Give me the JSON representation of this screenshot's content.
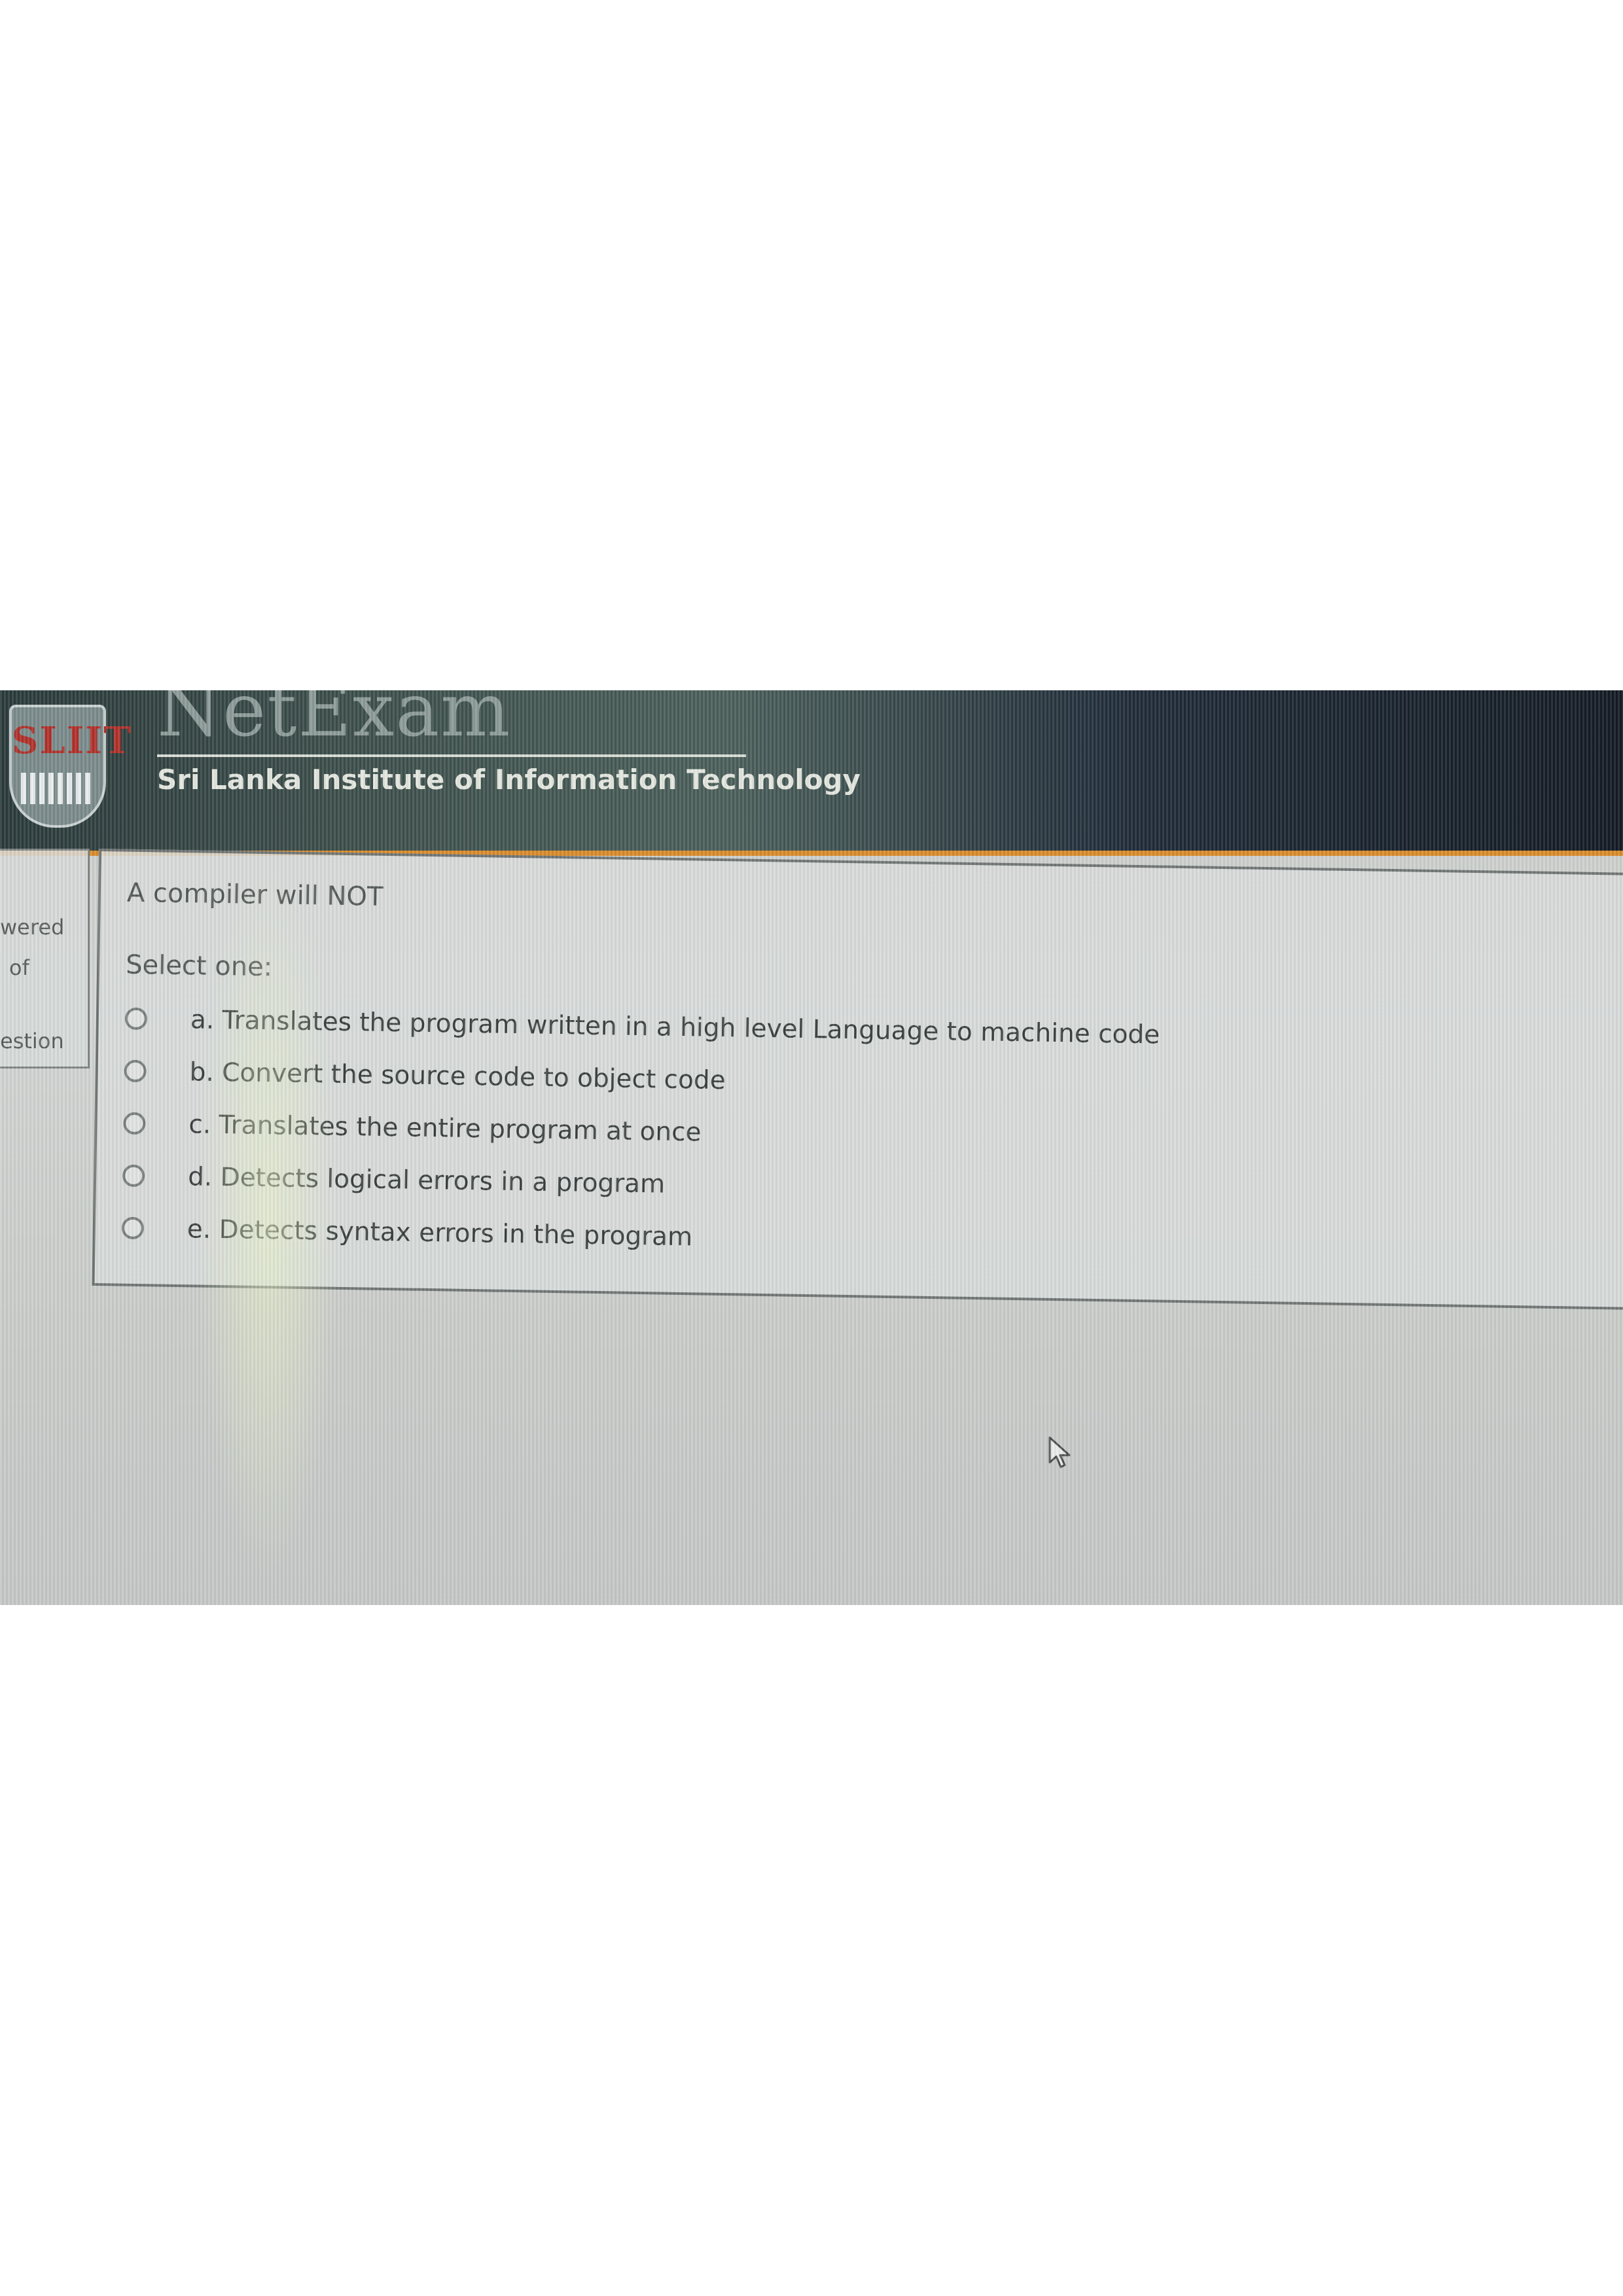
{
  "header": {
    "brand_title": "NetExam",
    "institute_name": "Sri Lanka Institute of Information Technology",
    "logo_text": "SLIIT"
  },
  "nav": {
    "line1": "wered",
    "line2": "of",
    "line3": "estion"
  },
  "question": {
    "text": "A compiler will NOT",
    "prompt": "Select one:",
    "options": [
      {
        "label": "a. Translates the program written in a high level Language to machine code"
      },
      {
        "label": "b. Convert the source code to object code"
      },
      {
        "label": "c. Translates the entire program at once"
      },
      {
        "label": "d. Detects logical errors in a program"
      },
      {
        "label": "e. Detects syntax errors in the program"
      }
    ]
  },
  "colors": {
    "header_accent": "#d98a2a",
    "logo_text": "#b0302a",
    "screen_background": "#cfd2d0"
  },
  "icons": {
    "logo": "sliit-shield-logo",
    "radio": "radio-button-unchecked",
    "cursor": "mouse-pointer-icon"
  }
}
